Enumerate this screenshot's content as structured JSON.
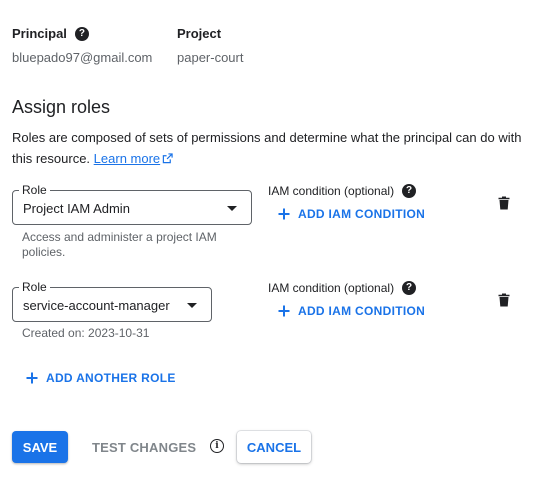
{
  "principal": {
    "label": "Principal",
    "value": "bluepado97@gmail.com",
    "help_icon": "help-circle-icon"
  },
  "project": {
    "label": "Project",
    "value": "paper-court"
  },
  "assign_roles": {
    "title": "Assign roles",
    "description": "Roles are composed of sets of permissions and determine what the principal can do with this resource.",
    "learn_more": "Learn more",
    "learn_more_icon": "open-in-new-icon"
  },
  "roles": [
    {
      "field_label": "Role",
      "value": "Project IAM Admin",
      "hint": "Access and administer a project IAM policies.",
      "condition_label": "IAM condition (optional)",
      "add_condition": "ADD IAM CONDITION"
    },
    {
      "field_label": "Role",
      "value": "service-account-manager",
      "hint": "Created on: 2023-10-31",
      "condition_label": "IAM condition (optional)",
      "add_condition": "ADD IAM CONDITION"
    }
  ],
  "add_another_role": "ADD ANOTHER ROLE",
  "actions": {
    "save": "SAVE",
    "test_changes": "TEST CHANGES",
    "cancel": "CANCEL"
  },
  "colors": {
    "accent": "#1a73e8",
    "text": "#202124",
    "muted": "#5f6368",
    "disabled": "#80868b"
  }
}
